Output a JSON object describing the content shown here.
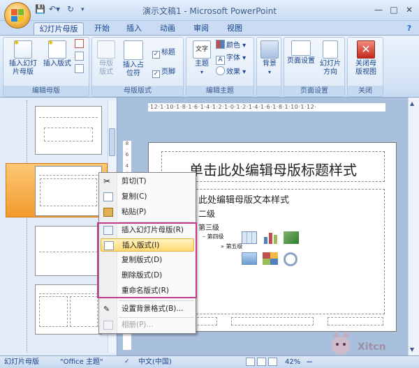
{
  "window": {
    "title": "演示文稿1 - Microsoft PowerPoint"
  },
  "tabs": [
    "幻灯片母版",
    "开始",
    "插入",
    "动画",
    "审阅",
    "视图"
  ],
  "ribbon": {
    "group_edit_master": {
      "label": "编辑母版",
      "insert_master": "插入幻灯片母版",
      "insert_layout": "插入版式"
    },
    "group_master_layout": {
      "label": "母版版式",
      "master_layout": "母版版式",
      "insert_placeholder": "插入占位符",
      "chk_title": "标题",
      "chk_footer": "页脚"
    },
    "group_edit_theme": {
      "label": "编辑主题",
      "theme": "主题",
      "colors": "颜色",
      "fonts": "字体",
      "effects": "效果"
    },
    "group_background": {
      "background": "背景"
    },
    "group_page_setup": {
      "label": "页面设置",
      "page_setup": "页面设置",
      "orientation": "幻灯片方向"
    },
    "group_close": {
      "label": "关闭",
      "close_master": "关闭母版视图"
    }
  },
  "slide": {
    "title": "单击此处编辑母版标题样式",
    "body_l1": "此处编辑母版文本样式",
    "body_l2": "二级",
    "body_l3": "第三级",
    "body_l4": "– 第四级",
    "body_l5": "» 第五级"
  },
  "context_menu": [
    {
      "label": "剪切(T)",
      "icon": "scissors-icon",
      "enabled": true
    },
    {
      "label": "复制(C)",
      "icon": "copy-icon",
      "enabled": true
    },
    {
      "label": "粘贴(P)",
      "icon": "paste-icon",
      "enabled": true
    },
    {
      "label": "插入幻灯片母版(R)",
      "icon": "insert-master-icon",
      "enabled": true
    },
    {
      "label": "插入版式(I)",
      "icon": "insert-layout-icon",
      "enabled": true,
      "highlighted": true
    },
    {
      "label": "复制版式(D)",
      "icon": "",
      "enabled": true
    },
    {
      "label": "删除版式(D)",
      "icon": "",
      "enabled": true
    },
    {
      "label": "重命名版式(R)",
      "icon": "",
      "enabled": true
    },
    {
      "label": "设置背景格式(B)...",
      "icon": "background-format-icon",
      "enabled": true
    },
    {
      "label": "相册(P)...",
      "icon": "album-icon",
      "enabled": false
    }
  ],
  "status": {
    "view": "幻灯片母版",
    "theme": "\"Office 主题\"",
    "language": "中文(中国)",
    "zoom": "42%"
  },
  "watermark": {
    "text": "Xitcn"
  },
  "colors": {
    "highlight_border": "#c23a8e",
    "ribbon_bg": "#dbe8f7",
    "accent": "#15428b"
  }
}
